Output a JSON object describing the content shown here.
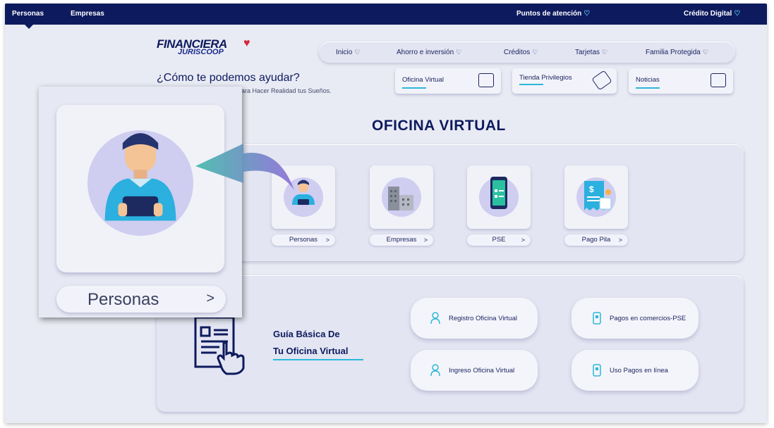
{
  "topbar": {
    "tabs": [
      "Personas",
      "Empresas"
    ],
    "points": "Puntos de atención",
    "credit": "Crédito Digital"
  },
  "logo": {
    "line1": "FINANCIERA",
    "line2": "JURISCOOP"
  },
  "nav": [
    "Inicio",
    "Ahorro e inversión",
    "Créditos",
    "Tarjetas",
    "Familia Protegida"
  ],
  "help": {
    "title": "¿Cómo te podemos ayudar?",
    "subtitle": "ara Hacer Realidad tus Sueños."
  },
  "quick": [
    "Oficina Virtual",
    "Tienda Privilegios",
    "Noticias"
  ],
  "section_title": "OFICINA VIRTUAL",
  "services": [
    "Personas",
    "Empresas",
    "PSE",
    "Pago Pila"
  ],
  "guide": {
    "line1": "Guía Básica De",
    "line2": "Tu Oficina Virtual",
    "buttons": [
      "Registro Oficina Virtual",
      "Pagos en comercios-PSE",
      "Ingreso Oficina Virtual",
      "Uso Pagos en línea"
    ]
  },
  "zoom": {
    "label": "Personas"
  },
  "colors": {
    "navy": "#0d1a5e",
    "accent": "#2bb8d8",
    "heart": "#d8253b",
    "bg": "#e9ebf4"
  }
}
